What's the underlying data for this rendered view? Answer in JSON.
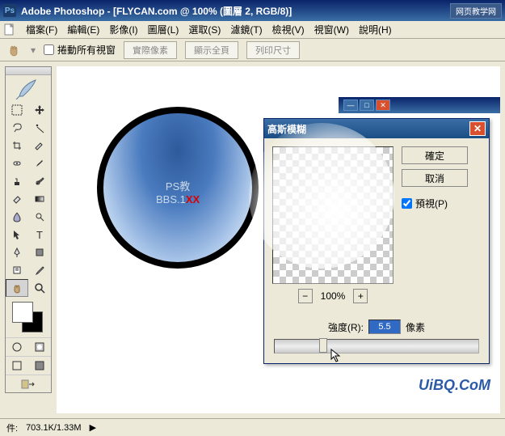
{
  "app": {
    "title": "Adobe Photoshop - [FLYCAN.com @ 100% (圖層 2, RGB/8)]",
    "logo_tag": "网页教学网"
  },
  "menu": {
    "items": [
      "檔案(F)",
      "編輯(E)",
      "影像(I)",
      "圖層(L)",
      "選取(S)",
      "濾鏡(T)",
      "檢視(V)",
      "視窗(W)",
      "說明(H)"
    ]
  },
  "options": {
    "scroll_all": "捲動所有視窗",
    "actual_pixels": "實際像素",
    "fit_screen": "顯示全頁",
    "print_size": "列印尺寸"
  },
  "artwork": {
    "line1": "PS教",
    "line2": "BBS.1",
    "xx": "XX"
  },
  "dialog": {
    "title": "高斯模糊",
    "ok": "確定",
    "cancel": "取消",
    "preview": "預視(P)",
    "zoom": "100%",
    "radius_label": "強度(R):",
    "radius_value": "5.5",
    "radius_unit": "像素"
  },
  "status": {
    "doc_size_prefix": "件:",
    "doc_size": "703.1K/1.33M"
  },
  "brand": "UiBQ.CoM"
}
